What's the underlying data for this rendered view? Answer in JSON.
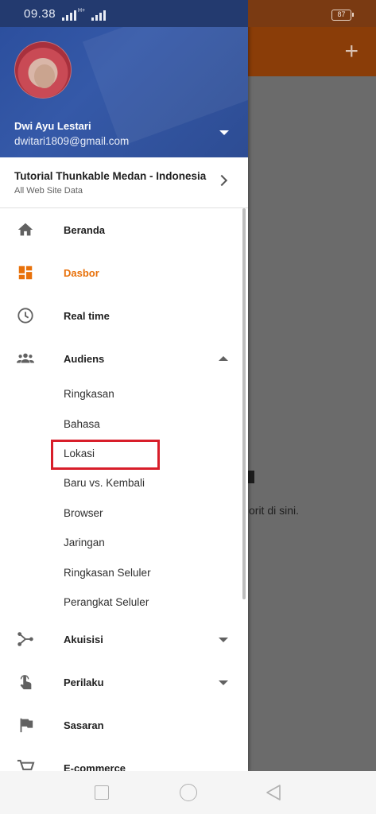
{
  "status_bar": {
    "time": "09.38",
    "network_type": "H+",
    "battery_level": "87"
  },
  "background_app": {
    "partial_text": "orit di sini."
  },
  "account": {
    "name": "Dwi Ayu Lestari",
    "email": "dwitari1809@gmail.com"
  },
  "property": {
    "name": "Tutorial Thunkable Medan - Indonesia",
    "view": "All Web Site Data"
  },
  "nav": {
    "home": "Beranda",
    "dashboard": "Dasbor",
    "realtime": "Real time",
    "audience": "Audiens",
    "acquisition": "Akuisisi",
    "behavior": "Perilaku",
    "goals": "Sasaran",
    "ecommerce": "E-commerce"
  },
  "audience_items": [
    "Ringkasan",
    "Bahasa",
    "Lokasi",
    "Baru vs. Kembali",
    "Browser",
    "Jaringan",
    "Ringkasan Seluler",
    "Perangkat Seluler"
  ],
  "colors": {
    "active_accent": "#e8710a",
    "highlight": "#d81e2a",
    "header_blue": "#2f52a0"
  }
}
